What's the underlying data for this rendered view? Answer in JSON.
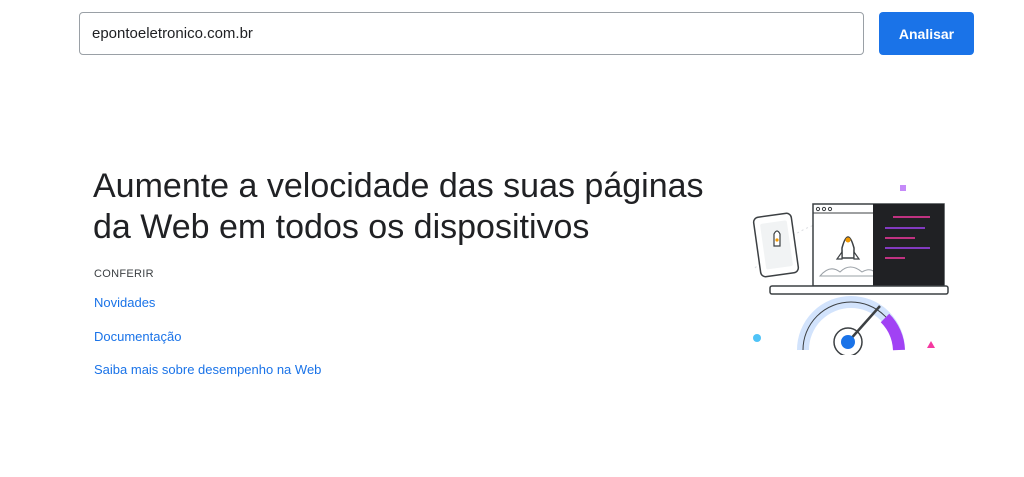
{
  "search": {
    "value": "epontoeletronico.com.br",
    "button_label": "Analisar"
  },
  "hero": {
    "title": "Aumente a velocidade das suas páginas da Web em todos os dispositivos",
    "section_label": "CONFERIR",
    "links": [
      {
        "label": "Novidades"
      },
      {
        "label": "Documentação"
      },
      {
        "label": "Saiba mais sobre desempenho na Web"
      }
    ]
  },
  "illustration": {
    "icon": "speed-gauge-illustration",
    "colors": {
      "accent_blue": "#1a73e8",
      "gauge_purple": "#a142f4",
      "pink": "#f538a0",
      "light_blue": "#4fc3f7",
      "code_bg": "#202124"
    }
  }
}
